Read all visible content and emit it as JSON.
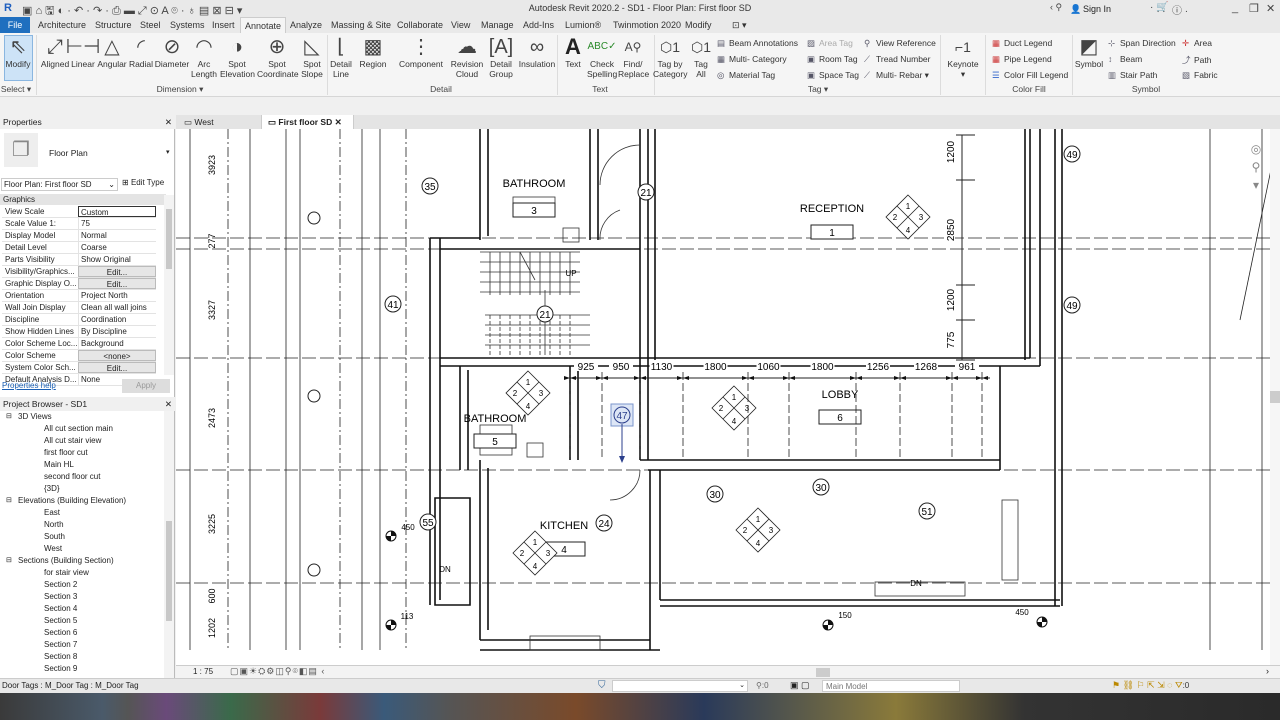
{
  "window": {
    "title": "Autodesk Revit 2020.2 - SD1 - Floor Plan: First floor SD",
    "sign_in": "Sign In"
  },
  "ribbon_tabs": [
    "File",
    "Architecture",
    "Structure",
    "Steel",
    "Systems",
    "Insert",
    "Annotate",
    "Analyze",
    "Massing & Site",
    "Collaborate",
    "View",
    "Manage",
    "Add-Ins",
    "Lumion®",
    "Twinmotion 2020",
    "Modify"
  ],
  "active_tab": "Annotate",
  "ribbon": {
    "select": {
      "modify": "Modify",
      "panel": "Select ▾"
    },
    "dimension": {
      "aligned": "Aligned",
      "linear": "Linear",
      "angular": "Angular",
      "radial": "Radial",
      "diameter": "Diameter",
      "arc_length": "Arc Length",
      "spot_elevation": "Spot Elevation",
      "spot_coordinate": "Spot Coordinate",
      "spot_slope": "Spot Slope",
      "panel": "Dimension ▾"
    },
    "detail": {
      "detail_line": "Detail Line",
      "region": "Region",
      "component": "Component",
      "revision_cloud": "Revision Cloud",
      "detail_group": "Detail Group",
      "insulation": "Insulation",
      "panel": "Detail"
    },
    "text": {
      "text": "Text",
      "check_spelling": "Check Spelling",
      "find_replace": "Find/ Replace",
      "panel": "Text"
    },
    "tag": {
      "tag_by_category": "Tag by Category",
      "tag_all": "Tag All",
      "beam_annotations": "Beam Annotations",
      "multi_category": "Multi- Category",
      "material_tag": "Material Tag",
      "area_tag": "Area Tag",
      "room_tag": "Room Tag",
      "space_tag": "Space Tag",
      "view_reference": "View Reference",
      "tread_number": "Tread Number",
      "multi_rebar": "Multi- Rebar ▾",
      "panel": "Tag ▾"
    },
    "keynote": "Keynote",
    "color_fill": {
      "duct_legend": "Duct Legend",
      "pipe_legend": "Pipe Legend",
      "color_fill_legend": "Color Fill Legend",
      "panel": "Color Fill"
    },
    "symbol": {
      "symbol": "Symbol",
      "span_direction": "Span Direction",
      "beam": "Beam",
      "stair_path": "Stair Path",
      "area": "Area",
      "path": "Path",
      "fabric": "Fabric",
      "panel": "Symbol"
    }
  },
  "view_tabs": [
    {
      "label": "West"
    },
    {
      "label": "First floor SD",
      "active": true
    }
  ],
  "properties": {
    "title": "Properties",
    "type": "Floor Plan",
    "selector": "Floor Plan: First floor SD",
    "edit_type": "Edit Type",
    "group": "Graphics",
    "rows": [
      [
        "View Scale",
        "Custom"
      ],
      [
        "Scale Value    1:",
        "75"
      ],
      [
        "Display Model",
        "Normal"
      ],
      [
        "Detail Level",
        "Coarse"
      ],
      [
        "Parts Visibility",
        "Show Original"
      ],
      [
        "Visibility/Graphics...",
        "Edit..."
      ],
      [
        "Graphic Display O...",
        "Edit..."
      ],
      [
        "Orientation",
        "Project North"
      ],
      [
        "Wall Join Display",
        "Clean all wall joins"
      ],
      [
        "Discipline",
        "Coordination"
      ],
      [
        "Show Hidden Lines",
        "By Discipline"
      ],
      [
        "Color Scheme Loc...",
        "Background"
      ],
      [
        "Color Scheme",
        "<none>"
      ],
      [
        "System Color Sch...",
        "Edit..."
      ],
      [
        "Default Analysis D...",
        "None"
      ]
    ],
    "help": "Properties help",
    "apply": "Apply"
  },
  "browser": {
    "title": "Project Browser - SD1",
    "items": [
      {
        "label": "3D Views",
        "level": 1
      },
      {
        "label": "All cut section main",
        "level": 2
      },
      {
        "label": "All cut stair view",
        "level": 2
      },
      {
        "label": "first floor cut",
        "level": 2
      },
      {
        "label": "Main HL",
        "level": 2
      },
      {
        "label": "second floor cut",
        "level": 2
      },
      {
        "label": "{3D}",
        "level": 2
      },
      {
        "label": "Elevations (Building Elevation)",
        "level": 1
      },
      {
        "label": "East",
        "level": 2
      },
      {
        "label": "North",
        "level": 2
      },
      {
        "label": "South",
        "level": 2
      },
      {
        "label": "West",
        "level": 2
      },
      {
        "label": "Sections (Building Section)",
        "level": 1
      },
      {
        "label": "for stair view",
        "level": 2
      },
      {
        "label": "Section 2",
        "level": 2
      },
      {
        "label": "Section 3",
        "level": 2
      },
      {
        "label": "Section 4",
        "level": 2
      },
      {
        "label": "Section 5",
        "level": 2
      },
      {
        "label": "Section 6",
        "level": 2
      },
      {
        "label": "Section 7",
        "level": 2
      },
      {
        "label": "Section 8",
        "level": 2
      },
      {
        "label": "Section 9",
        "level": 2
      }
    ]
  },
  "plan": {
    "rooms": [
      {
        "name": "BATHROOM",
        "number": "3"
      },
      {
        "name": "RECEPTION",
        "number": "1"
      },
      {
        "name": "LOBBY",
        "number": "6"
      },
      {
        "name": "BATHROOM",
        "number": "5"
      },
      {
        "name": "KITCHEN",
        "number": "4"
      }
    ],
    "door_tags": [
      "35",
      "21",
      "41",
      "21",
      "47",
      "30",
      "30",
      "51",
      "24",
      "55",
      "49",
      "49"
    ],
    "selected_tag": "47",
    "horizontal_dims": [
      "925",
      "950",
      "1130",
      "1800",
      "1060",
      "1800",
      "1256",
      "1268",
      "961"
    ],
    "left_dims": [
      "3923",
      "277",
      "3327",
      "2473",
      "3225",
      "600",
      "1202"
    ],
    "right_dims": [
      "1200",
      "2850",
      "1200",
      "775"
    ],
    "spot_labels": [
      "450",
      "113",
      "150",
      "450"
    ],
    "stair_labels": [
      "UP",
      "DN",
      "DN"
    ],
    "quadrant_numbers": [
      "1",
      "2",
      "3",
      "4"
    ]
  },
  "view_control": {
    "scale": "1 : 75"
  },
  "status": {
    "text": "Door Tags : M_Door Tag : M_Door Tag",
    "workset": ":0",
    "model": "Main Model",
    "filter": ":0"
  }
}
